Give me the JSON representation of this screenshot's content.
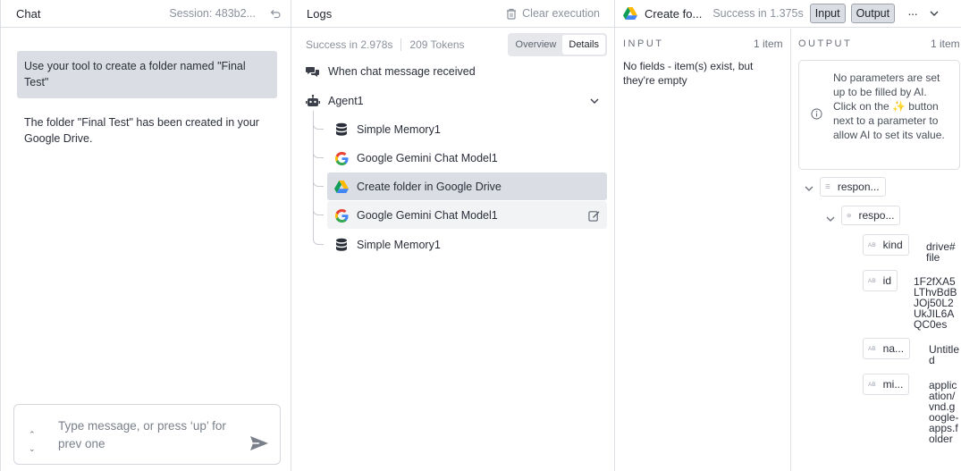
{
  "chat": {
    "title": "Chat",
    "session": "Session: 483b2...",
    "user_message": "Use your tool to create a folder named \"Final Test\"",
    "bot_message": "The folder \"Final Test\" has been created in your Google Drive.",
    "input_placeholder": "Type message, or press ‘up’ for prev one"
  },
  "logs": {
    "title": "Logs",
    "clear_label": "Clear execution",
    "status": "Success in 2.978s",
    "tokens": "209 Tokens",
    "view_tabs": [
      "Overview",
      "Details"
    ],
    "active_tab": "Details",
    "trigger": "When chat message received",
    "agent": "Agent1",
    "children": [
      {
        "label": "Simple Memory1",
        "icon": "database-icon"
      },
      {
        "label": "Google Gemini Chat Model1",
        "icon": "google-icon"
      },
      {
        "label": "Create folder in Google Drive",
        "icon": "google-drive-icon",
        "selected": true
      },
      {
        "label": "Google Gemini Chat Model1",
        "icon": "google-icon",
        "hovered": true
      },
      {
        "label": "Simple Memory1",
        "icon": "database-icon"
      }
    ]
  },
  "detail": {
    "node_title": "Create fo...",
    "status": "Success in 1.375s",
    "input_button": "Input",
    "output_button": "Output",
    "input": {
      "label": "INPUT",
      "count": "1 item",
      "message": "No fields - item(s) exist, but they're empty"
    },
    "output": {
      "label": "OUTPUT",
      "count": "1 item",
      "info": "No parameters are set up to be filled by AI. Click on the ✨ button next to a parameter to allow AI to set its value.",
      "tree": {
        "root": "respon...",
        "child": "respo...",
        "fields": [
          {
            "type": "AB",
            "key": "kind",
            "value": "drive#file"
          },
          {
            "type": "AB",
            "key": "id",
            "value": "1F2fXA5LThvBdBJOj50L2UkJIL6AQC0es"
          },
          {
            "type": "AB",
            "key": "na...",
            "value": "Untitled"
          },
          {
            "type": "AB",
            "key": "mi...",
            "value": "application/vnd.google-apps.folder"
          }
        ]
      }
    }
  },
  "colors": {
    "selected_row": "#dadde3",
    "hover_row": "#f2f3f5",
    "border": "#dcdfe4"
  }
}
